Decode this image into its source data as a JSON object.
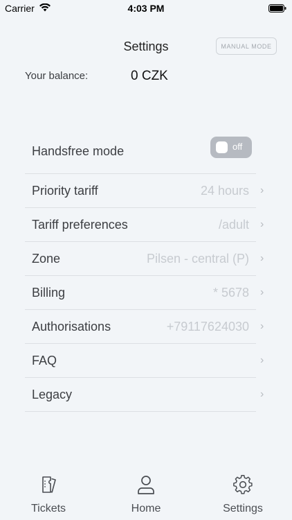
{
  "status_bar": {
    "carrier": "Carrier",
    "time": "4:03 PM"
  },
  "header": {
    "title": "Settings",
    "manual_mode_label": "MANUAL MODE"
  },
  "balance": {
    "label": "Your balance:",
    "value": "0 CZK"
  },
  "settings": {
    "handsfree": {
      "label": "Handsfree mode",
      "toggle_text": "off",
      "enabled": false
    },
    "items": [
      {
        "label": "Priority tariff",
        "value": "24 hours"
      },
      {
        "label": "Tariff preferences",
        "value": "/adult"
      },
      {
        "label": "Zone",
        "value": "Pilsen - central (P)"
      },
      {
        "label": "Billing",
        "value": "* 5678"
      },
      {
        "label": "Authorisations",
        "value": "+79117624030"
      },
      {
        "label": "FAQ",
        "value": ""
      },
      {
        "label": "Legacy",
        "value": ""
      }
    ]
  },
  "tabbar": {
    "tabs": [
      {
        "label": "Tickets",
        "icon": "tickets-icon"
      },
      {
        "label": "Home",
        "icon": "person-icon"
      },
      {
        "label": "Settings",
        "icon": "gear-icon"
      }
    ]
  }
}
